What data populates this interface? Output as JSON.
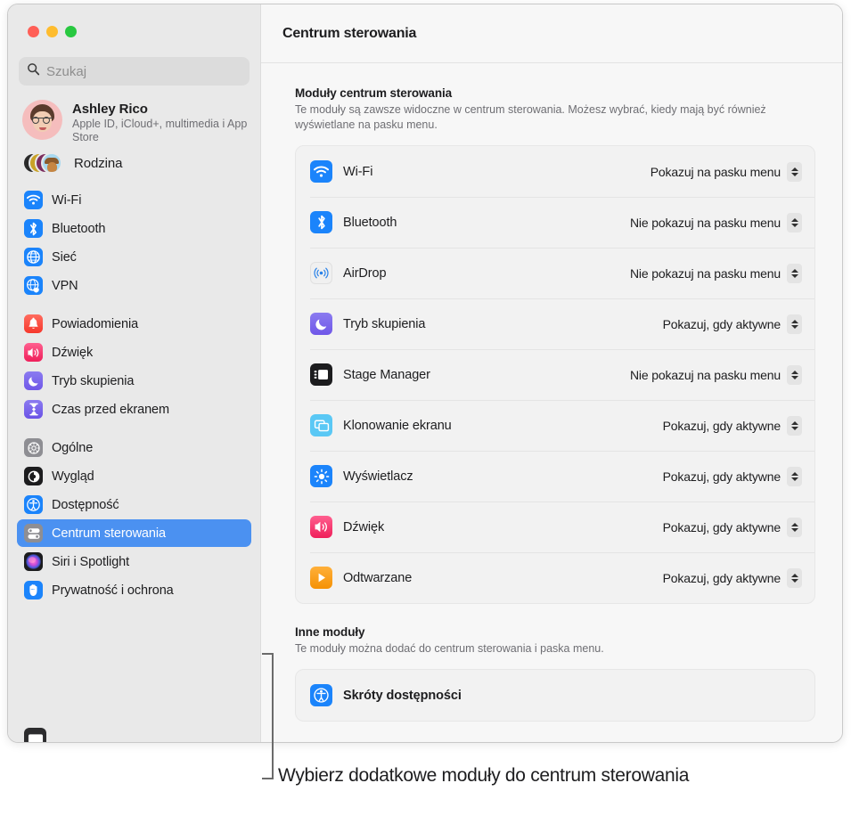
{
  "window": {
    "traffic_lights": [
      "close",
      "minimize",
      "zoom"
    ],
    "search": {
      "placeholder": "Szukaj",
      "value": "",
      "icon": "search-icon"
    }
  },
  "sidebar": {
    "account": {
      "name": "Ashley Rico",
      "subtitle": "Apple ID, iCloud+, multimedia i App Store"
    },
    "family": {
      "label": "Rodzina"
    },
    "groups": [
      {
        "items": [
          {
            "label": "Wi-Fi",
            "icon": "wifi-icon",
            "selected": false
          },
          {
            "label": "Bluetooth",
            "icon": "bluetooth-icon",
            "selected": false
          },
          {
            "label": "Sieć",
            "icon": "network-globe-icon",
            "selected": false
          },
          {
            "label": "VPN",
            "icon": "vpn-globe-icon",
            "selected": false
          }
        ]
      },
      {
        "items": [
          {
            "label": "Powiadomienia",
            "icon": "notifications-bell-icon",
            "selected": false
          },
          {
            "label": "Dźwięk",
            "icon": "sound-speaker-icon",
            "selected": false
          },
          {
            "label": "Tryb skupienia",
            "icon": "focus-moon-icon",
            "selected": false
          },
          {
            "label": "Czas przed ekranem",
            "icon": "screen-time-hourglass-icon",
            "selected": false
          }
        ]
      },
      {
        "items": [
          {
            "label": "Ogólne",
            "icon": "general-gear-icon",
            "selected": false
          },
          {
            "label": "Wygląd",
            "icon": "appearance-icon",
            "selected": false
          },
          {
            "label": "Dostępność",
            "icon": "accessibility-icon",
            "selected": false
          },
          {
            "label": "Centrum sterowania",
            "icon": "control-center-icon",
            "selected": true
          },
          {
            "label": "Siri i Spotlight",
            "icon": "siri-icon",
            "selected": false
          },
          {
            "label": "Prywatność i ochrona",
            "icon": "privacy-hand-icon",
            "selected": false
          }
        ]
      }
    ]
  },
  "content": {
    "title": "Centrum sterowania",
    "sections": [
      {
        "heading": "Moduły centrum sterowania",
        "description": "Te moduły są zawsze widoczne w centrum sterowania. Możesz wybrać, kiedy mają być również wyświetlane na pasku menu.",
        "rows": [
          {
            "label": "Wi-Fi",
            "icon": "wifi-icon",
            "value": "Pokazuj na pasku menu"
          },
          {
            "label": "Bluetooth",
            "icon": "bluetooth-icon",
            "value": "Nie pokazuj na pasku menu"
          },
          {
            "label": "AirDrop",
            "icon": "airdrop-icon",
            "value": "Nie pokazuj na pasku menu"
          },
          {
            "label": "Tryb skupienia",
            "icon": "focus-moon-icon",
            "value": "Pokazuj, gdy aktywne"
          },
          {
            "label": "Stage Manager",
            "icon": "stage-manager-icon",
            "value": "Nie pokazuj na pasku menu"
          },
          {
            "label": "Klonowanie ekranu",
            "icon": "screen-mirroring-icon",
            "value": "Pokazuj, gdy aktywne"
          },
          {
            "label": "Wyświetlacz",
            "icon": "display-brightness-icon",
            "value": "Pokazuj, gdy aktywne"
          },
          {
            "label": "Dźwięk",
            "icon": "sound-speaker-icon",
            "value": "Pokazuj, gdy aktywne"
          },
          {
            "label": "Odtwarzane",
            "icon": "now-playing-icon",
            "value": "Pokazuj, gdy aktywne"
          }
        ]
      },
      {
        "heading": "Inne moduły",
        "description": "Te moduły można dodać do centrum sterowania i paska menu.",
        "rows": [
          {
            "label": "Skróty dostępności",
            "icon": "accessibility-icon",
            "value": ""
          }
        ]
      }
    ]
  },
  "callout": {
    "text": "Wybierz dodatkowe moduły do centrum sterowania"
  },
  "colors": {
    "accent_blue": "#4b91f1",
    "icon_blue": "#1b84fb",
    "sidebar_bg": "#e9e9e9",
    "content_bg": "#f7f7f7",
    "card_bg": "#f2f2f2",
    "text_primary": "#1d1d1f",
    "text_secondary": "#6e6e73"
  }
}
